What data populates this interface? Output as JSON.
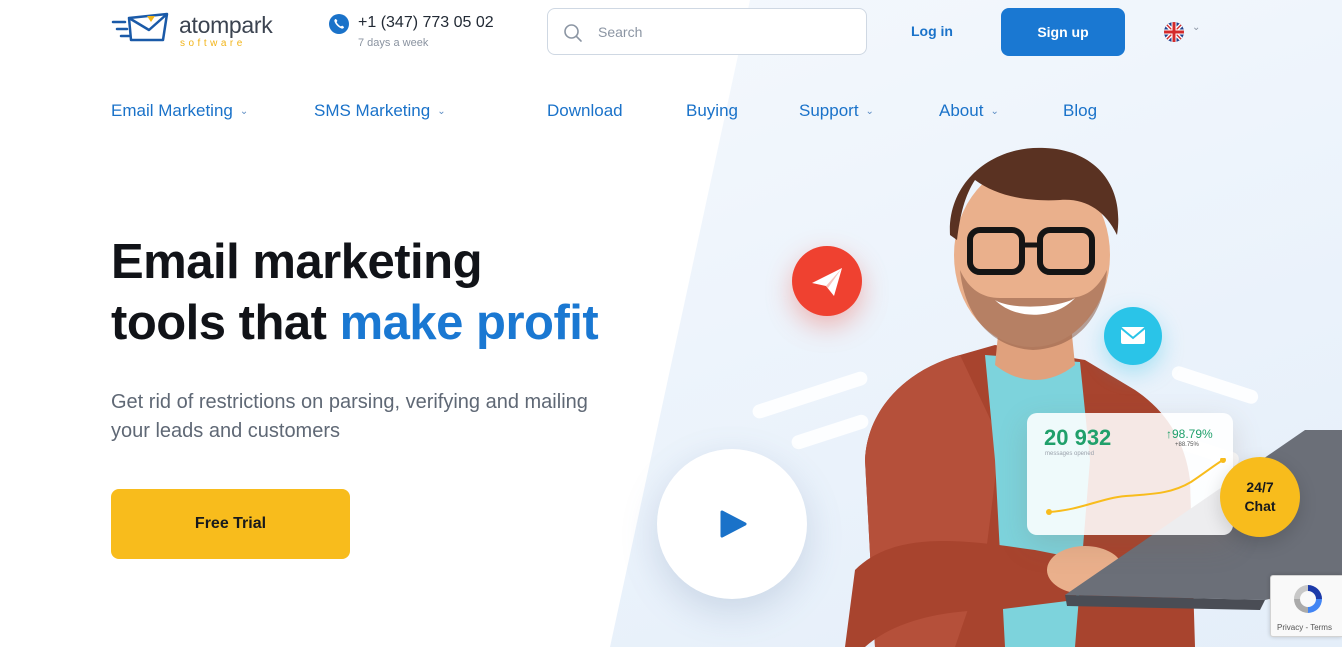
{
  "brand": {
    "name": "atompark",
    "sub": "software"
  },
  "contact": {
    "phone": "+1 (347) 773 05 02",
    "hours": "7 days a week"
  },
  "search": {
    "placeholder": "Search"
  },
  "auth": {
    "login": "Log in",
    "signup": "Sign up"
  },
  "language": {
    "icon": "uk-flag-icon"
  },
  "nav": {
    "items": [
      {
        "label": "Email Marketing",
        "has_menu": true
      },
      {
        "label": "SMS Marketing",
        "has_menu": true
      },
      {
        "label": "Download",
        "has_menu": false
      },
      {
        "label": "Buying",
        "has_menu": false
      },
      {
        "label": "Support",
        "has_menu": true
      },
      {
        "label": "About",
        "has_menu": true
      },
      {
        "label": "Blog",
        "has_menu": false
      }
    ]
  },
  "hero": {
    "title_line1": "Email marketing",
    "title_line2_plain": "tools that ",
    "title_line2_accent": "make profit",
    "subtitle": "Get rid of restrictions on parsing, verifying and mailing your leads and customers",
    "cta": "Free Trial"
  },
  "stats_card": {
    "value": "20 932",
    "label": "messages opened",
    "percent": "98.79%",
    "delta": "+88.75%"
  },
  "chat": {
    "line1": "24/7",
    "line2": "Chat"
  },
  "recaptcha": {
    "footer": "Privacy - Terms"
  },
  "colors": {
    "primary": "#1a78d2",
    "accent": "#f8bc1c",
    "text": "#111318"
  }
}
